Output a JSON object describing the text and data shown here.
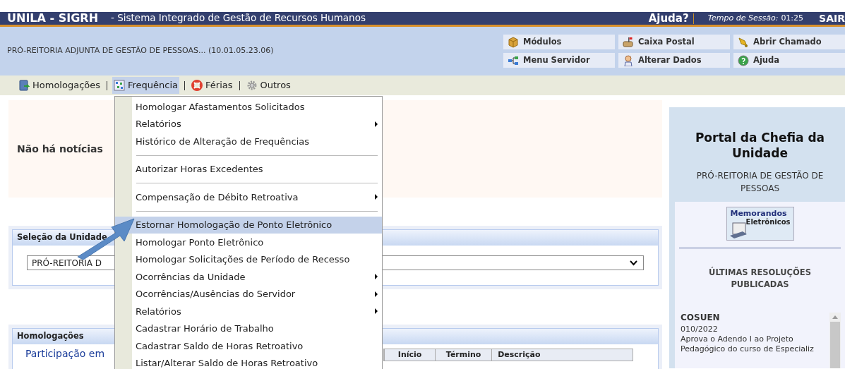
{
  "header": {
    "system": "UNILA - SIGRH",
    "subtitle": "- Sistema Integrado de Gestão de Recursos Humanos",
    "help": "Ajuda?",
    "session_label": "Tempo de Sessão:",
    "session_time": "01:25",
    "logout": "SAIR"
  },
  "unit_bar": {
    "unit": "PRÓ-REITORIA ADJUNTA DE GESTÃO DE PESSOAS... (10.01.05.23.06)",
    "shortcuts": [
      {
        "label": "Módulos"
      },
      {
        "label": "Caixa Postal"
      },
      {
        "label": "Abrir Chamado"
      },
      {
        "label": "Menu Servidor"
      },
      {
        "label": "Alterar Dados"
      },
      {
        "label": "Ajuda"
      }
    ]
  },
  "menu_bar": [
    {
      "label": "Homologações",
      "selected": false
    },
    {
      "label": "Frequência",
      "selected": true
    },
    {
      "label": "Férias",
      "selected": false
    },
    {
      "label": "Outros",
      "selected": false
    }
  ],
  "dropdown": [
    {
      "kind": "item",
      "label": "Homologar Afastamentos Solicitados",
      "submenu": false,
      "selected": false
    },
    {
      "kind": "item",
      "label": "Relatórios",
      "submenu": true,
      "selected": false
    },
    {
      "kind": "item",
      "label": "Histórico de Alteração de Frequências",
      "submenu": false,
      "selected": false
    },
    {
      "kind": "separator"
    },
    {
      "kind": "item",
      "label": "Autorizar Horas Excedentes",
      "submenu": false,
      "selected": false
    },
    {
      "kind": "separator"
    },
    {
      "kind": "item",
      "label": "Compensação de Débito Retroativa",
      "submenu": true,
      "selected": false
    },
    {
      "kind": "separator"
    },
    {
      "kind": "item",
      "label": "Estornar Homologação de Ponto Eletrônico",
      "submenu": false,
      "selected": true
    },
    {
      "kind": "item",
      "label": "Homologar Ponto Eletrônico",
      "submenu": false,
      "selected": false
    },
    {
      "kind": "item",
      "label": "Homologar Solicitações de Período de Recesso",
      "submenu": false,
      "selected": false
    },
    {
      "kind": "item",
      "label": "Ocorrências da Unidade",
      "submenu": true,
      "selected": false
    },
    {
      "kind": "item",
      "label": "Ocorrências/Ausências do Servidor",
      "submenu": true,
      "selected": false
    },
    {
      "kind": "item",
      "label": "Relatórios",
      "submenu": true,
      "selected": false
    },
    {
      "kind": "item",
      "label": "Cadastrar Horário de Trabalho",
      "submenu": false,
      "selected": false
    },
    {
      "kind": "item",
      "label": "Cadastrar Saldo de Horas Retroativo",
      "submenu": false,
      "selected": false
    },
    {
      "kind": "item",
      "label": "Listar/Alterar Saldo de Horas Retroativo",
      "submenu": false,
      "selected": false
    }
  ],
  "news": {
    "text": "Não há notícias"
  },
  "unit_selection": {
    "title": "Seleção da Unidade",
    "value": "PRÓ-REITORIA D"
  },
  "approvals": {
    "title": "Homologações",
    "link": "Participação em",
    "columns": [
      "Início",
      "Término",
      "Descrição"
    ]
  },
  "sidebar": {
    "title": "Portal da Chefia da Unidade",
    "unit": "PRÓ-REITORIA DE GESTÃO DE PESSOAS",
    "memo_line1": "Memorandos",
    "memo_line2": "Eletrônicos",
    "resolutions_title": "ÚLTIMAS RESOLUÇÕES PUBLICADAS",
    "resolutions": [
      {
        "council": "COSUEN",
        "number": "010/2022",
        "text": "Aprova o Adendo I ao Projeto Pedagógico do curso de Especializ"
      }
    ]
  }
}
